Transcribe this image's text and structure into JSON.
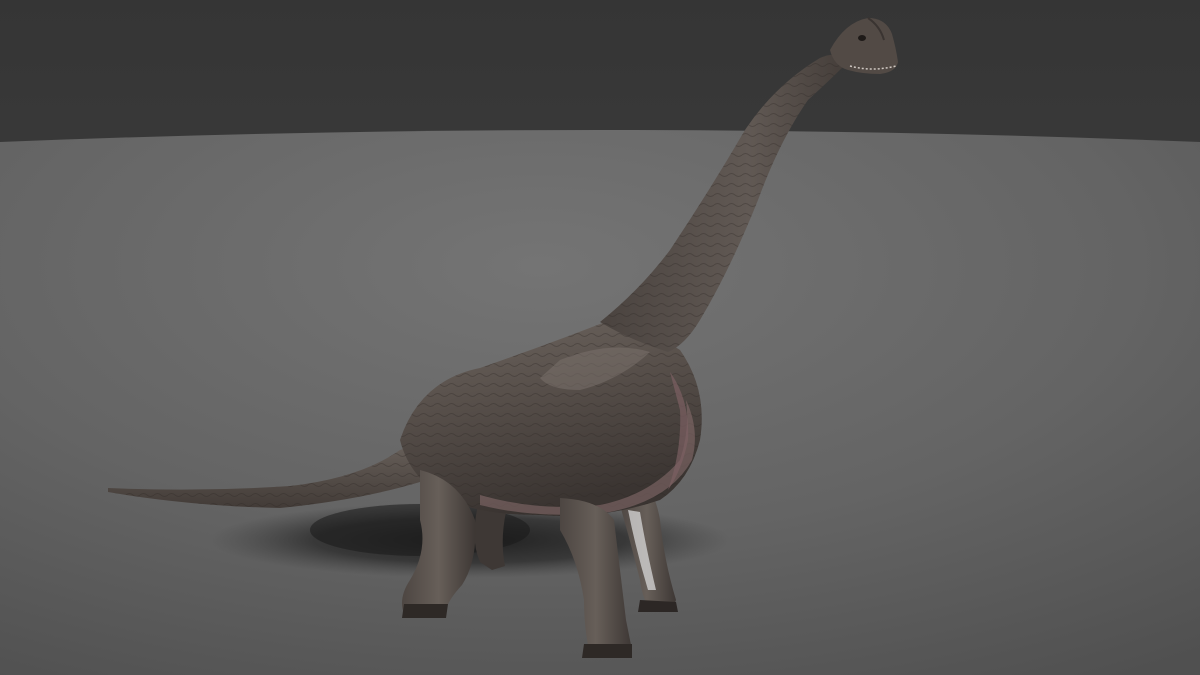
{
  "scene": {
    "subject": "brachiosaurus-render",
    "colors": {
      "background_top": "#3d3d3d",
      "floor_far": "#707070",
      "floor_near": "#555555",
      "skin_dark": "#3f3a36",
      "skin_mid": "#5c5550",
      "skin_light": "#7a716b",
      "underbelly": "#8a6f70",
      "shadow": "#262626"
    }
  }
}
